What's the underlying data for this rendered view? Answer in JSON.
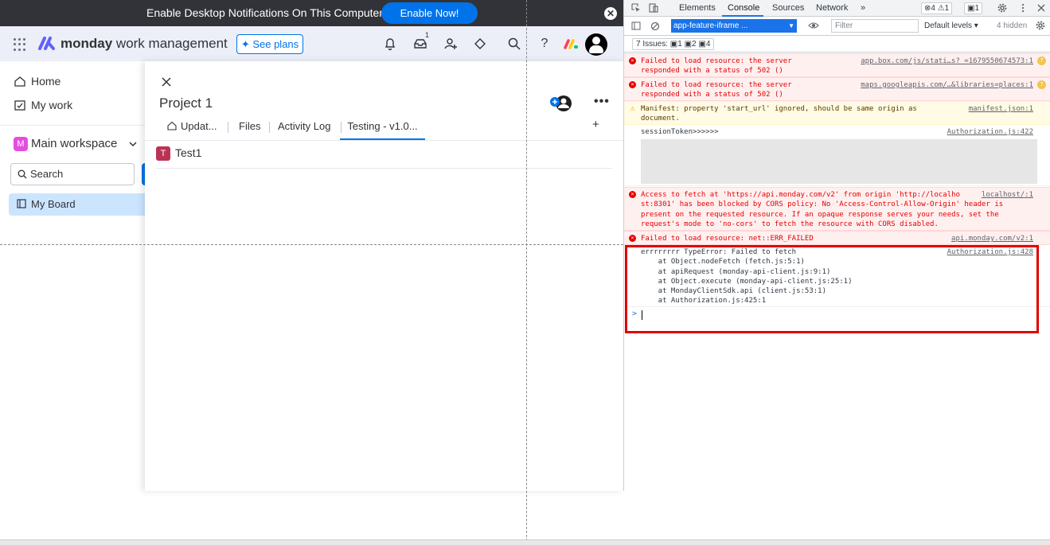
{
  "notification": {
    "message": "Enable Desktop Notifications On This Computer",
    "button": "Enable Now!",
    "close": "✕"
  },
  "topbar": {
    "brand_bold": "monday",
    "brand_rest": " work management",
    "see_plans": "✦ See plans",
    "inbox_count": "1",
    "help": "?"
  },
  "sidebar": {
    "home": "Home",
    "my_work": "My work",
    "workspace": "Main workspace",
    "workspace_initial": "M",
    "search_placeholder": "Search",
    "board": "My Board"
  },
  "panel": {
    "title": "Project 1",
    "tabs": [
      "Updat...",
      "Files",
      "Activity Log",
      "Testing - v1.0..."
    ],
    "item_initial": "T",
    "item_name": "Test1",
    "more": "•••",
    "add": "+"
  },
  "devtools": {
    "tabs": [
      "Elements",
      "Console",
      "Sources",
      "Network"
    ],
    "more_tabs": "»",
    "error_badge": "⊗4  ⚠1",
    "issue_badge": "▣1",
    "context": "app-feature-iframe ...",
    "filter_placeholder": "Filter",
    "levels": "Default levels ▾",
    "hidden": "4 hidden",
    "issues": "7 Issues:  ▣1  ▣2  ▣4",
    "logs": [
      {
        "type": "err",
        "text": "Failed to load resource: the server\nresponded with a status of 502 ()",
        "src": "app.box.com/js/stati…s?_=1679550674573:1"
      },
      {
        "type": "err",
        "text": "Failed to load resource: the server\nresponded with a status of 502 ()",
        "src": "maps.googleapis.com/…&libraries=places:1"
      },
      {
        "type": "warn",
        "text": "Manifest: property 'start_url' ignored, should be same origin as\ndocument.",
        "src": "manifest.json:1"
      },
      {
        "type": "log",
        "text": "sessionToken>>>>>>",
        "src": "Authorization.js:422"
      },
      {
        "type": "err",
        "text": "Access to fetch at 'https://api.monday.com/v2' from origin 'http://localho\nst:8301' has been blocked by CORS policy: No 'Access-Control-Allow-Origin' header is\npresent on the requested resource. If an opaque response serves your needs, set the\nrequest's mode to 'no-cors' to fetch the resource with CORS disabled.",
        "src": "localhost/:1"
      },
      {
        "type": "err",
        "text": "Failed to load resource: net::ERR_FAILED",
        "src": "api.monday.com/v2:1"
      },
      {
        "type": "log",
        "text": "errrrrrrr TypeError: Failed to fetch\n    at Object.nodeFetch (fetch.js:5:1)\n    at apiRequest (monday-api-client.js:9:1)\n    at Object.execute (monday-api-client.js:25:1)\n    at MondayClientSdk.api (client.js:53:1)\n    at Authorization.js:425:1",
        "src": "Authorization.js:428"
      }
    ],
    "prompt": ">"
  }
}
